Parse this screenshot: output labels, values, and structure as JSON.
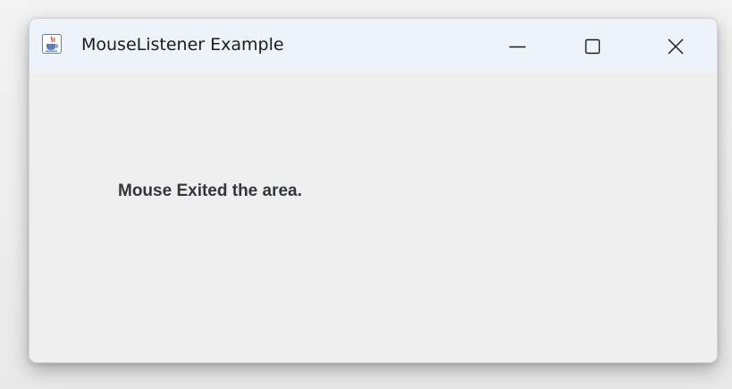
{
  "window": {
    "title": "MouseListener Example",
    "icon": "java-coffee-cup-icon",
    "controls": {
      "minimize": "minimize-icon",
      "maximize": "maximize-icon",
      "close": "close-icon"
    }
  },
  "content": {
    "status_text": "Mouse Exited the area."
  },
  "colors": {
    "titlebar": "#eef3f9",
    "content_background": "#efefef",
    "label_text": "#33363a"
  }
}
